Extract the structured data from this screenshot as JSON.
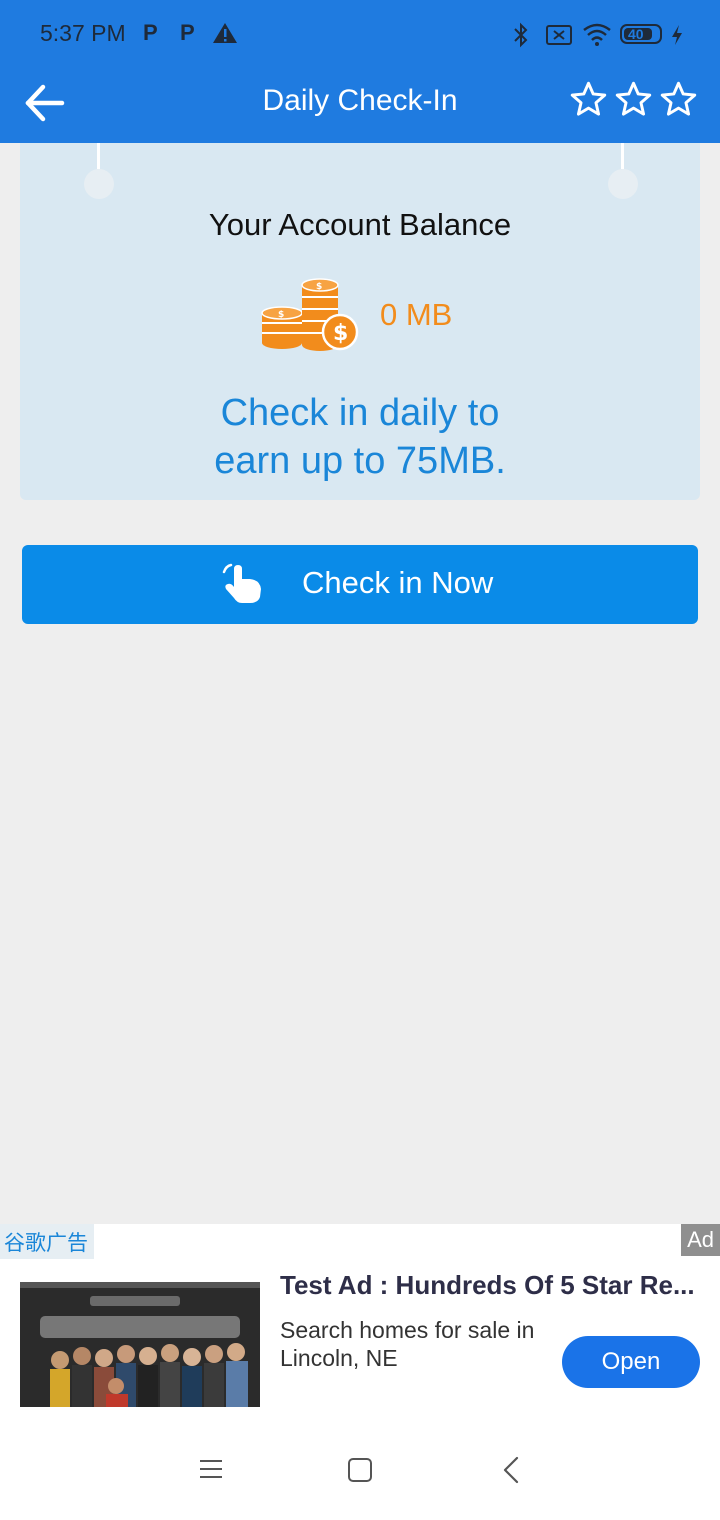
{
  "status_bar": {
    "time": "5:37 PM",
    "left_icons": [
      "p-icon",
      "p-icon",
      "alert-icon"
    ],
    "right_icons": [
      "bluetooth-icon",
      "sim-off-icon",
      "wifi-icon",
      "battery-icon",
      "charging-icon"
    ],
    "battery_text": "40"
  },
  "app_bar": {
    "title": "Daily Check-In",
    "back_icon": "arrow-left-icon",
    "rating_icons": [
      "star-outline-icon",
      "star-outline-icon",
      "star-outline-icon"
    ]
  },
  "balance": {
    "title": "Your Account Balance",
    "value": "0 MB",
    "promo_line1": "Check in daily to",
    "promo_line2": "earn up to 75MB."
  },
  "checkin_button": {
    "label": "Check in Now",
    "icon": "hand-tap-icon"
  },
  "ad": {
    "tag": "谷歌广告",
    "badge": "Ad",
    "title": "Test Ad : Hundreds Of 5 Star Re...",
    "description": "Search homes for sale in Lincoln, NE",
    "cta": "Open"
  },
  "nav_bar": {
    "icons": [
      "menu-icon",
      "home-square-icon",
      "back-chevron-icon"
    ]
  },
  "colors": {
    "primary": "#1f7be0",
    "button": "#0a8be8",
    "accent_orange": "#f28c1c",
    "promo_blue": "#1a86d8",
    "card_bg": "#d9e8f2",
    "page_bg": "#eeeeee"
  }
}
